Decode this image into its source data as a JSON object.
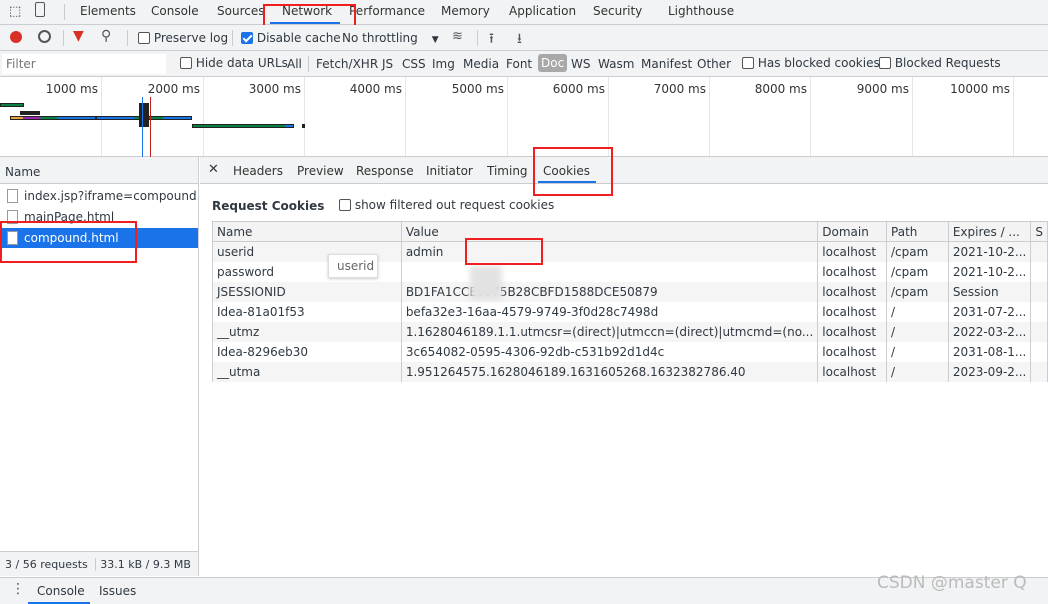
{
  "main_tabs": [
    "Elements",
    "Console",
    "Sources",
    "Network",
    "Performance",
    "Memory",
    "Application",
    "Security",
    "Lighthouse"
  ],
  "active_main_tab": "Network",
  "toolbar": {
    "preserve_log": "Preserve log",
    "preserve_log_checked": false,
    "disable_cache": "Disable cache",
    "disable_cache_checked": true,
    "throttling": "No throttling"
  },
  "filterbar": {
    "filter_placeholder": "Filter",
    "hide_data_urls": "Hide data URLs",
    "types": [
      "All",
      "Fetch/XHR",
      "JS",
      "CSS",
      "Img",
      "Media",
      "Font",
      "Doc",
      "WS",
      "Wasm",
      "Manifest",
      "Other"
    ],
    "active_type": "Doc",
    "has_blocked_cookies": "Has blocked cookies",
    "blocked_requests": "Blocked Requests"
  },
  "timeline": {
    "ticks": [
      "1000 ms",
      "2000 ms",
      "3000 ms",
      "4000 ms",
      "5000 ms",
      "6000 ms",
      "7000 ms",
      "8000 ms",
      "9000 ms",
      "10000 ms"
    ]
  },
  "requests": {
    "header": "Name",
    "items": [
      "index.jsp?iframe=compound.h...",
      "mainPage.html",
      "compound.html"
    ],
    "selected": "compound.html"
  },
  "status": {
    "requests": "3 / 56 requests",
    "transferred": "33.1 kB / 9.3 MB"
  },
  "detail_tabs": [
    "Headers",
    "Preview",
    "Response",
    "Initiator",
    "Timing",
    "Cookies"
  ],
  "active_detail_tab": "Cookies",
  "cookies": {
    "section_title": "Request Cookies",
    "show_filtered": "show filtered out request cookies",
    "columns": [
      "Name",
      "Value",
      "Domain",
      "Path",
      "Expires / ...",
      "S"
    ],
    "rows": [
      [
        "userid",
        "admin",
        "localhost",
        "/cpam",
        "2021-10-2..."
      ],
      [
        "password",
        "",
        "localhost",
        "/cpam",
        "2021-10-2..."
      ],
      [
        "JSESSIONID",
        "BD1FA1CCE9975B28CBFD1588DCE50879",
        "localhost",
        "/cpam",
        "Session"
      ],
      [
        "Idea-81a01f53",
        "befa32e3-16aa-4579-9749-3f0d28c7498d",
        "localhost",
        "/",
        "2031-07-2..."
      ],
      [
        "__utmz",
        "1.1628046189.1.1.utmcsr=(direct)|utmccn=(direct)|utmcmd=(no...",
        "localhost",
        "/",
        "2022-03-2..."
      ],
      [
        "Idea-8296eb30",
        "3c654082-0595-4306-92db-c531b92d1d4c",
        "localhost",
        "/",
        "2031-08-1..."
      ],
      [
        "__utma",
        "1.951264575.1628046189.1631605268.1632382786.40",
        "localhost",
        "/",
        "2023-09-2..."
      ]
    ],
    "tooltip": "userid"
  },
  "drawer": {
    "tabs": [
      "Console",
      "Issues"
    ]
  },
  "watermark": "CSDN @master Q"
}
